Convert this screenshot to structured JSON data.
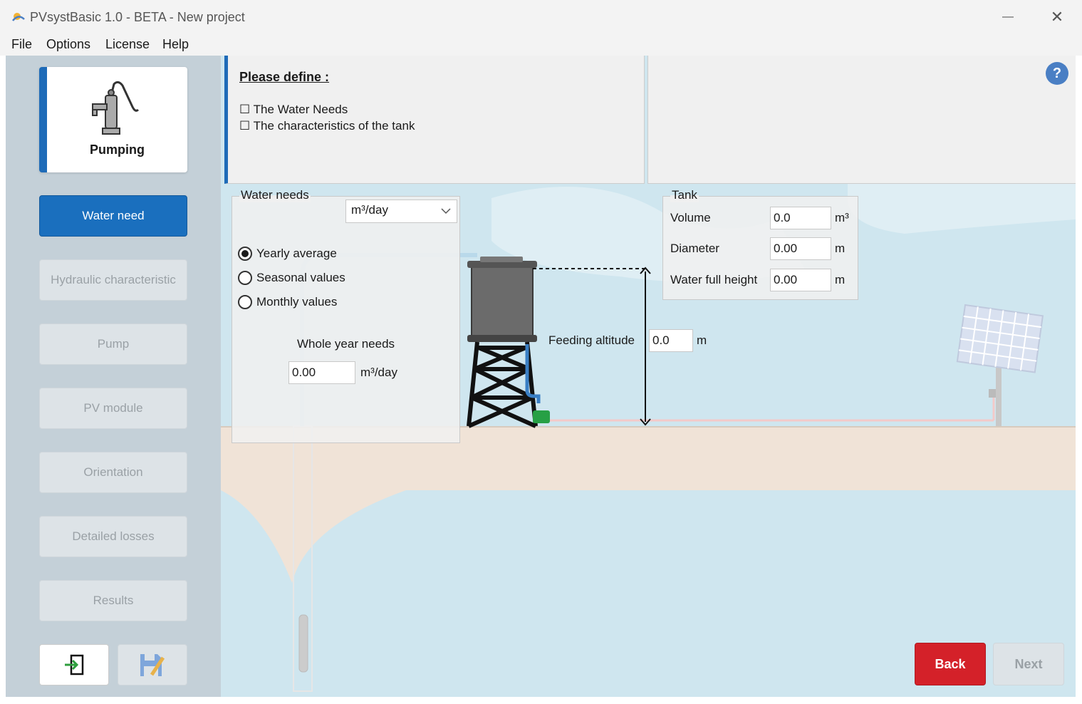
{
  "window": {
    "title": "PVsystBasic 1.0 - BETA - New project",
    "minimize_glyph": "—",
    "close_glyph": "✕"
  },
  "menu": [
    "File",
    "Options",
    "License",
    "Help"
  ],
  "sidebar": {
    "logo_label": "Pumping",
    "items": [
      {
        "label": "Water need",
        "active": true
      },
      {
        "label": "Hydraulic characteristic",
        "active": false
      },
      {
        "label": "Pump",
        "active": false
      },
      {
        "label": "PV module",
        "active": false
      },
      {
        "label": "Orientation",
        "active": false
      },
      {
        "label": "Detailed losses",
        "active": false
      },
      {
        "label": "Results",
        "active": false
      }
    ],
    "bottom_icons": [
      "import-icon",
      "save-icon"
    ]
  },
  "info": {
    "title": "Please define :",
    "checklist": [
      "The Water Needs",
      "The characteristics of the tank"
    ],
    "checkbox_glyph": "☐",
    "help_glyph": "?"
  },
  "water_needs": {
    "legend": "Water needs",
    "unit_select": "m³/day",
    "options": [
      "Yearly average",
      "Seasonal values",
      "Monthly values"
    ],
    "selected": "Yearly average",
    "whole_year_label": "Whole year needs",
    "whole_year_value": "0.00",
    "whole_year_unit": "m³/day"
  },
  "tank": {
    "legend": "Tank",
    "volume_label": "Volume",
    "volume_value": "0.0",
    "volume_unit": "m³",
    "diameter_label": "Diameter",
    "diameter_value": "0.00",
    "diameter_unit": "m",
    "height_label": "Water full height",
    "height_value": "0.00",
    "height_unit": "m"
  },
  "feeding": {
    "label": "Feeding altitude",
    "value": "0.0",
    "unit": "m"
  },
  "actions": {
    "back": "Back",
    "next": "Next"
  },
  "colors": {
    "accent": "#1a6fbe",
    "back": "#d42129",
    "sidebar": "#c4d0d8",
    "sky": "#cfe6ef",
    "ground": "#f0e3d7"
  }
}
